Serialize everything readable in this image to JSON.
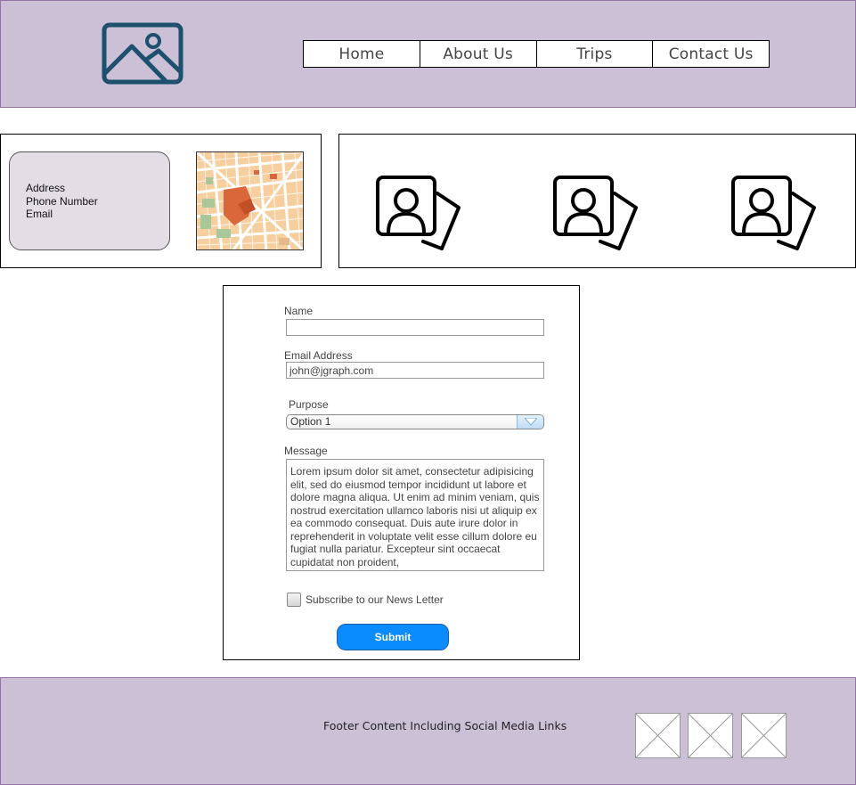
{
  "header": {
    "logo_icon": "image-placeholder-icon",
    "nav": [
      "Home",
      "About Us",
      "Trips",
      "Contact Us"
    ]
  },
  "contact": {
    "address_label": "Address",
    "phone_label": "Phone Number",
    "email_label": "Email",
    "map_icon": "city-map-image"
  },
  "team": {
    "icons": [
      "person-card-icon",
      "person-card-icon",
      "person-card-icon"
    ]
  },
  "form": {
    "name_label": "Name",
    "name_value": "",
    "email_label": "Email Address",
    "email_value": "john@jgraph.com",
    "purpose_label": "Purpose",
    "purpose_selected": "Option 1",
    "message_label": "Message",
    "message_value": "Lorem ipsum dolor sit amet, consectetur adipisicing elit, sed do eiusmod tempor incididunt ut labore et dolore magna aliqua. Ut enim ad minim veniam, quis nostrud exercitation ullamco laboris nisi ut aliquip ex ea commodo consequat. Duis aute irure dolor in reprehenderit in voluptate velit esse cillum dolore eu fugiat nulla pariatur. Excepteur sint occaecat cupidatat non proident,",
    "newsletter_label": "Subscribe to our News Letter",
    "newsletter_checked": false,
    "submit_label": "Submit"
  },
  "footer": {
    "text": "Footer Content Including Social Media Links",
    "social_icons": [
      "image-placeholder-x",
      "image-placeholder-x",
      "image-placeholder-x"
    ]
  },
  "colors": {
    "band": "#ccc0d6",
    "band_border": "#9673a6",
    "logo": "#1d4f6e",
    "submit": "#0a8cff",
    "contact_card": "#e3dde6"
  }
}
